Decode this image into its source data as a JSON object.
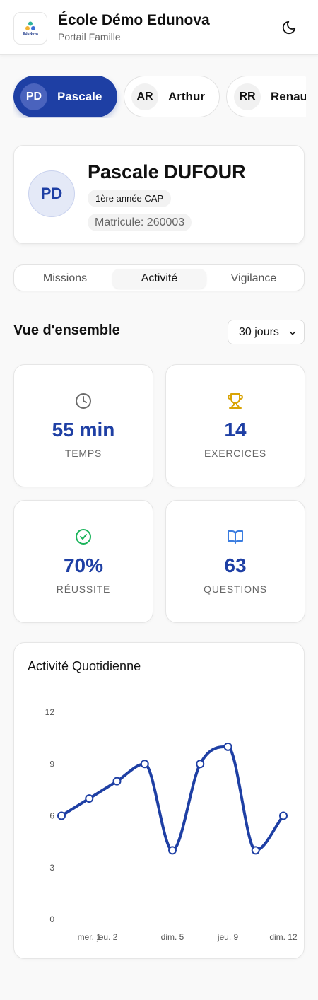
{
  "header": {
    "logo_text": "EduNova",
    "school_name": "École Démo Edunova",
    "portal_name": "Portail Famille",
    "theme_icon": "moon-icon"
  },
  "students": [
    {
      "initials": "PD",
      "name": "Pascale",
      "active": true
    },
    {
      "initials": "AR",
      "name": "Arthur",
      "active": false
    },
    {
      "initials": "RR",
      "name": "Renaud",
      "active": false
    }
  ],
  "profile": {
    "initials": "PD",
    "full_name": "Pascale DUFOUR",
    "class_label": "1ère année CAP",
    "matricule": "Matricule: 260003"
  },
  "tabs": [
    {
      "label": "Missions",
      "active": false
    },
    {
      "label": "Activité",
      "active": true
    },
    {
      "label": "Vigilance",
      "active": false
    }
  ],
  "overview": {
    "title": "Vue d'ensemble",
    "period": "30 jours"
  },
  "stats": [
    {
      "value": "55 min",
      "label": "TEMPS",
      "icon": "clock-icon",
      "color": "#6b6b6b"
    },
    {
      "value": "14",
      "label": "EXERCICES",
      "icon": "trophy-icon",
      "color": "#d9a406"
    },
    {
      "value": "70%",
      "label": "RÉUSSITE",
      "icon": "check-circle-icon",
      "color": "#19b35a"
    },
    {
      "value": "63",
      "label": "QUESTIONS",
      "icon": "book-open-icon",
      "color": "#3b7de0"
    }
  ],
  "colors": {
    "accent": "#1e3fa4"
  },
  "chart_data": {
    "type": "line",
    "title": "Activité Quotidienne",
    "x": [
      0,
      1,
      2,
      3,
      4,
      5,
      6,
      7,
      8
    ],
    "values": [
      6,
      7,
      8,
      9,
      4,
      9,
      10,
      4,
      6
    ],
    "tick_labels": [
      {
        "x": 1,
        "label": "mer. 1"
      },
      {
        "x": 1.65,
        "label": "jeu. 2"
      },
      {
        "x": 4,
        "label": "dim. 5"
      },
      {
        "x": 6,
        "label": "jeu. 9"
      },
      {
        "x": 8,
        "label": "dim. 12"
      }
    ],
    "yticks": [
      0,
      3,
      6,
      9,
      12
    ],
    "ylim": [
      0,
      12
    ],
    "xlim": [
      0,
      8
    ],
    "grid": false,
    "color": "#1e3fa4"
  }
}
